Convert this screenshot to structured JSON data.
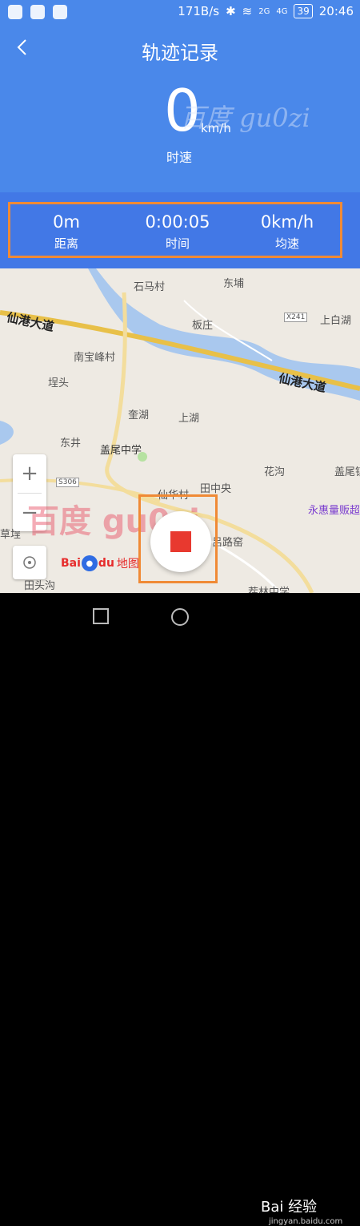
{
  "status_bar": {
    "network_speed": "171B/s",
    "signal_2g": "2G",
    "signal_4g": "4G",
    "battery": "39",
    "time": "20:46"
  },
  "header": {
    "title": "轨迹记录",
    "speed_value": "0",
    "speed_unit": "km/h",
    "speed_label": "时速"
  },
  "stats": [
    {
      "value": "0m",
      "label": "距离"
    },
    {
      "value": "0:00:05",
      "label": "时间"
    },
    {
      "value": "0km/h",
      "label": "均速"
    }
  ],
  "map": {
    "labels": [
      "石马村",
      "东埔",
      "上白湖",
      "板庄",
      "南宝峰村",
      "埕头",
      "奎湖",
      "上湖",
      "东井",
      "盖尾中学",
      "花沟",
      "盖尾镇",
      "田中央",
      "仙华村",
      "吕路窑",
      "永惠量贩超",
      "草埕",
      "田头沟",
      "茬林中学"
    ],
    "roads": [
      "仙港大道",
      "仙港大道",
      "X241",
      "S306"
    ],
    "zoom_in": "+",
    "zoom_out": "−",
    "logo_bai": "Bai",
    "logo_du": "du",
    "logo_map": "地图"
  },
  "watermarks": {
    "center": "百度 gu0zi",
    "map": "百度 gu0zi",
    "corner": "Bai 经验",
    "corner_url": "jingyan.baidu.com"
  },
  "colors": {
    "header": "#4a88ea",
    "stats_bar": "#4278e6",
    "highlight": "#f08a35",
    "stop": "#e8392f"
  }
}
